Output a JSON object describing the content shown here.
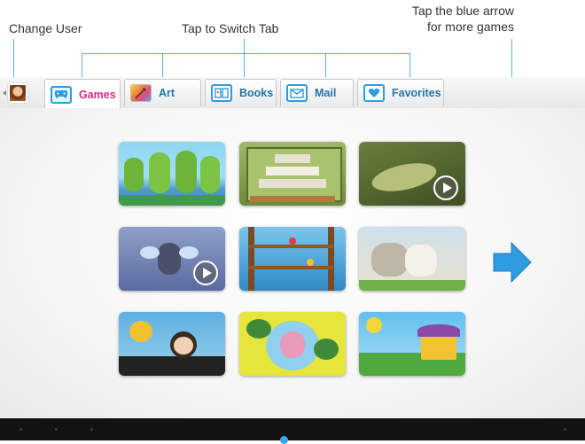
{
  "callouts": {
    "change_user": "Change User",
    "switch_tab": "Tap to Switch Tab",
    "blue_arrow_line1": "Tap the blue arrow",
    "blue_arrow_line2": "for more games"
  },
  "tabs": [
    {
      "label": "Games",
      "icon": "gamepad-icon",
      "active": true
    },
    {
      "label": "Art",
      "icon": "paint-palette-icon",
      "active": false
    },
    {
      "label": "Books",
      "icon": "book-icon",
      "active": false
    },
    {
      "label": "Mail",
      "icon": "envelope-icon",
      "active": false
    },
    {
      "label": "Favorites",
      "icon": "heart-icon",
      "active": false
    }
  ],
  "games": [
    {
      "scene": "frog band singing on lily pads",
      "has_play": false
    },
    {
      "scene": "word stacking puzzle board",
      "has_play": false
    },
    {
      "scene": "fish swimming underwater",
      "has_play": true
    },
    {
      "scene": "cartoon firefly",
      "has_play": true
    },
    {
      "scene": "birds on branches",
      "has_play": false
    },
    {
      "scene": "cat behind rock",
      "has_play": false
    },
    {
      "scene": "bee and girl at piano",
      "has_play": false
    },
    {
      "scene": "pink creature with broccoli",
      "has_play": false
    },
    {
      "scene": "cottage on sunny hill",
      "has_play": false
    }
  ],
  "colors": {
    "accent_blue": "#2f9be0",
    "active_tab_label": "#d62a8a",
    "tab_label": "#2375a8",
    "callout_line": "#5bb0e0"
  }
}
